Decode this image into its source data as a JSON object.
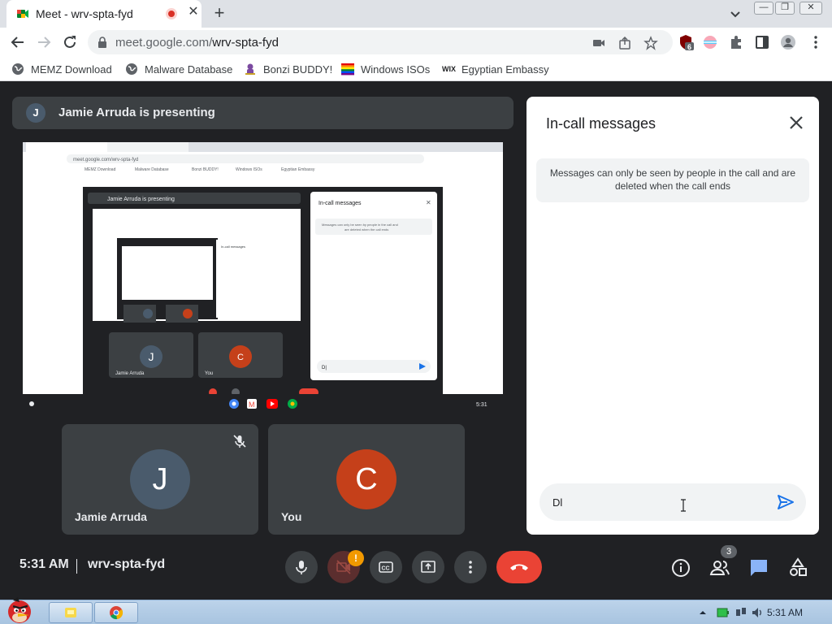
{
  "browser": {
    "tab_title": "Meet - wrv-spta-fyd",
    "url_host": "meet.google.com/",
    "url_path": "wrv-spta-fyd",
    "extension_badge": "6"
  },
  "bookmarks": [
    {
      "label": "MEMZ Download",
      "icon": "globe-icon"
    },
    {
      "label": "Malware Database",
      "icon": "globe-icon"
    },
    {
      "label": "Bonzi BUDDY!",
      "icon": "bonzi-icon"
    },
    {
      "label": "Windows ISOs",
      "icon": "windows-flag-icon"
    },
    {
      "label": "Egyptian Embassy",
      "icon": "wix-icon"
    }
  ],
  "presenter": {
    "initial": "J",
    "text": "Jamie Arruda is presenting"
  },
  "shared_screen": {
    "presenter_text": "Jamie Arruda is presenting",
    "chat_title": "In-call messages",
    "chat_notice": "Messages can only be seen by people in the call and are deleted when the call ends",
    "url": "meet.google.com/wrv-spta-fyd",
    "bookmarks": [
      "MEMZ Download",
      "Malware Database",
      "Bonzi BUDDY!",
      "Windows ISOs",
      "Egyptian Embassy"
    ],
    "tile1_name": "Jamie Arruda",
    "tile1_initial": "J",
    "tile2_name": "You",
    "tile2_initial": "C",
    "input_text": "D|",
    "clock": "5:31"
  },
  "participants": [
    {
      "initial": "J",
      "name": "Jamie Arruda",
      "color": "#4a5b6c",
      "muted": true
    },
    {
      "initial": "C",
      "name": "You",
      "color": "#c5401a",
      "muted": false
    }
  ],
  "chat": {
    "title": "In-call messages",
    "notice": "Messages can only be seen by people in the call and are deleted when the call ends",
    "input_value": "Dl"
  },
  "controls": {
    "time": "5:31 AM",
    "meeting_code": "wrv-spta-fyd",
    "camera_warning": "!",
    "people_count": "3"
  },
  "taskbar": {
    "time": "5:31 AM"
  },
  "colors": {
    "meet_bg": "#202124",
    "tile_bg": "#3c4043",
    "hangup_red": "#ea4335",
    "chat_blue": "#1a73e8",
    "you_avatar": "#c5401a"
  }
}
